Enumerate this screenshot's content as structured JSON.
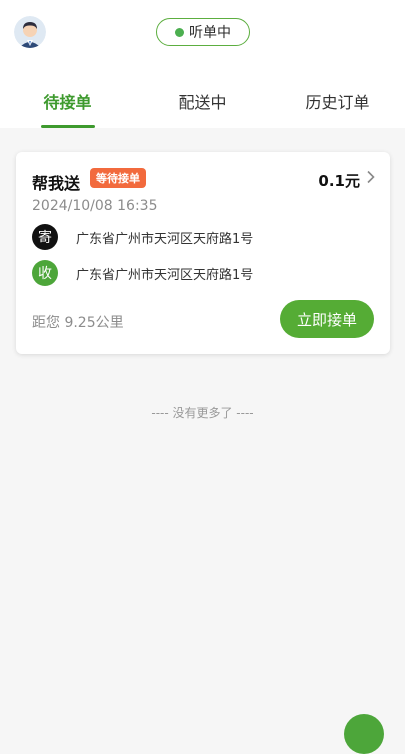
{
  "header": {
    "avatar_icon": "driver-avatar-icon",
    "listen_status": "听单中"
  },
  "tabs": [
    {
      "label": "待接单",
      "active": true
    },
    {
      "label": "配送中",
      "active": false
    },
    {
      "label": "历史订单",
      "active": false
    }
  ],
  "order": {
    "title": "帮我送",
    "status": "等待接单",
    "price": "0.1元",
    "time": "2024/10/08 16:35",
    "sender": {
      "badge": "寄",
      "address": "广东省广州市天河区天府路1号"
    },
    "receiver": {
      "badge": "收",
      "address": "广东省广州市天河区天府路1号"
    },
    "distance": "距您 9.25公里",
    "accept_label": "立即接单"
  },
  "footer": {
    "no_more": "---- 没有更多了 ----"
  },
  "colors": {
    "accent": "#4da63a",
    "badge": "#f26a3d"
  }
}
